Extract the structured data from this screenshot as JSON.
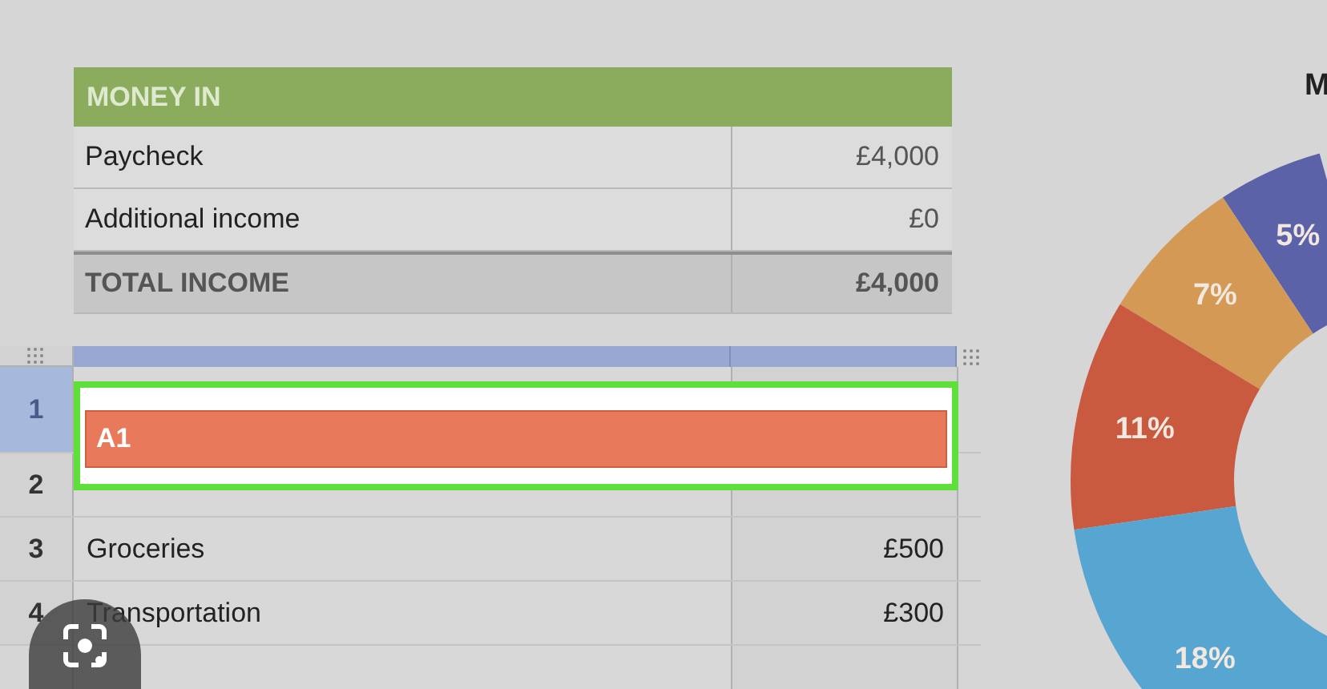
{
  "money_in": {
    "title": "MONEY IN",
    "rows": [
      {
        "label": "Paycheck",
        "amount": "£4,000",
        "kind": "item"
      },
      {
        "label": "Additional income",
        "amount": "£0",
        "kind": "item"
      },
      {
        "label": "TOTAL INCOME",
        "amount": "£4,000",
        "kind": "total"
      }
    ]
  },
  "sheet": {
    "rows": [
      {
        "number": "1",
        "selected": true
      },
      {
        "number": "2",
        "selected": false
      },
      {
        "number": "3",
        "selected": false,
        "cells": [
          "Groceries",
          "£500"
        ]
      },
      {
        "number": "4",
        "selected": false,
        "cells": [
          "Transportation",
          "£300"
        ]
      }
    ],
    "edit_cell": {
      "text": "A1"
    }
  },
  "chart": {
    "chart_data": {
      "type": "donut",
      "title": "M",
      "values": [
        5,
        7,
        11,
        18
      ],
      "colors": [
        "#5b62a8",
        "#d49a55",
        "#c9593f",
        "#57a5d1"
      ],
      "value_labels": [
        "5%",
        "7%",
        "11%",
        "18%"
      ]
    }
  }
}
